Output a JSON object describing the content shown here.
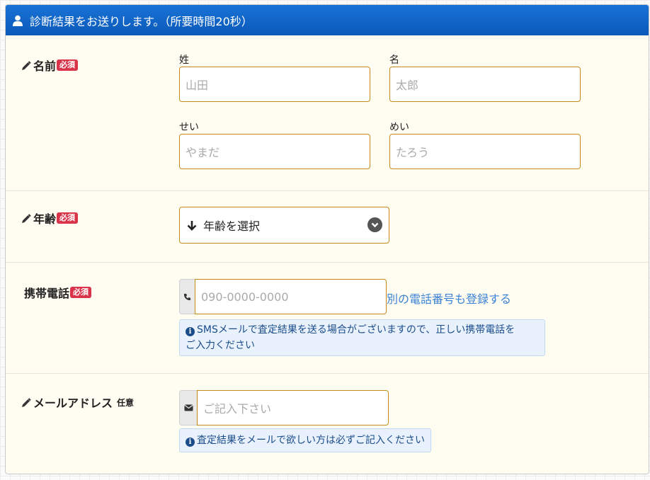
{
  "header": {
    "title": "診断結果をお送りします。（所要時間20秒）"
  },
  "badges": {
    "required": "必須",
    "optional": "任意"
  },
  "name_section": {
    "label": "名前",
    "last_name_label": "姓",
    "last_name_placeholder": "山田",
    "first_name_label": "名",
    "first_name_placeholder": "太郎",
    "last_kana_label": "せい",
    "last_kana_placeholder": "やまだ",
    "first_kana_label": "めい",
    "first_kana_placeholder": "たろう"
  },
  "age_section": {
    "label": "年齢",
    "select_value": "年齢を選択"
  },
  "phone_section": {
    "label": "携帯電話",
    "placeholder": "090-0000-0000",
    "add_link": "別の電話番号も登録する",
    "info_line1": "SMSメールで査定結果を送る場合がございますので、正しい携帯電話を",
    "info_line2": "ご入力ください"
  },
  "email_section": {
    "label": "メールアドレス",
    "placeholder": "ご記入下さい",
    "info": "査定結果をメールで欲しい方は必ずご記入ください"
  },
  "icons": {
    "header": "user-icon",
    "label": "pencil-icon",
    "select_prefix": "arrow-down-icon",
    "select_caret": "chevron-down-circle-icon",
    "phone": "phone-icon",
    "email": "envelope-icon",
    "info": "info-circle-icon"
  },
  "colors": {
    "header": "#0a59b9",
    "panel": "#fffcf1",
    "field_border": "#c48a1a",
    "badge": "#d9334a",
    "link": "#3a82d6"
  }
}
